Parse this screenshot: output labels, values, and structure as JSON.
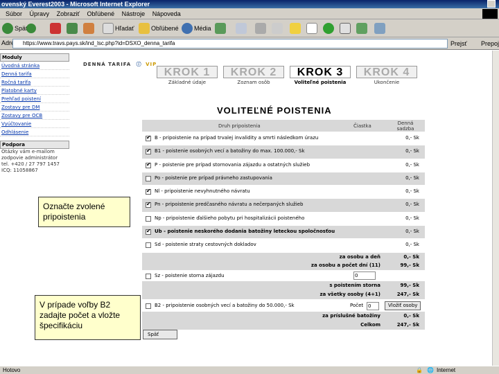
{
  "window": {
    "title": "ovenský Everest2003 - Microsoft Internet Explorer"
  },
  "menu": [
    "Súbor",
    "Úpravy",
    "Zobraziť",
    "Obľúbené",
    "Nástroje",
    "Nápoveda"
  ],
  "toolbar": {
    "back": "Späť",
    "search": "Hľadať",
    "favorites": "Obľúbené",
    "media": "Média"
  },
  "address": {
    "label": "Adresa",
    "url": "https://www.travs.pays.sk/ind_lsc.php?id=DSXO_denna_tarifa",
    "go": "Prejsť",
    "links": "Prepojenia"
  },
  "sidebar": {
    "modules_heading": "Moduly",
    "items": [
      "Úvodná stránka",
      "Denná tarifa",
      "Ročná tarifa",
      "Platobné karty",
      "Prehľad poistení",
      "Zostavy pre DM",
      "Zostavy pre OCB",
      "Vyúčtovanie",
      "Odhlásenie"
    ],
    "support_heading": "Podpora",
    "support_text": "Otázky vám e-mailom\nzodpovie administrátor\ntel. +420 / 27 797 1457\nICQ: 11058867"
  },
  "page": {
    "breadcrumb": "DENNÁ TARIFA",
    "vip": "VIP",
    "heading": "VOLITEĽNÉ POISTENIA"
  },
  "steps": [
    {
      "label": "KROK 1",
      "sub": "Základné údaje"
    },
    {
      "label": "KROK 2",
      "sub": "Zoznam osôb"
    },
    {
      "label": "KROK 3",
      "sub": "Voliteľné poistenia",
      "active": true
    },
    {
      "label": "KROK 4",
      "sub": "Ukončenie"
    }
  ],
  "table": {
    "col_type": "Druh pripoistenia",
    "col_amount": "Čiastka",
    "col_daily": "Denná sadzba",
    "rows": [
      {
        "checked": true,
        "desc": "B - pripoistenie na prípad trvalej invalidity a smrti následkom úrazu",
        "price": "0,- Sk"
      },
      {
        "checked": true,
        "desc": "B1 - poistenie osobných vecí a batožiny do max. 100.000,- Sk",
        "price": "0,- Sk"
      },
      {
        "checked": true,
        "desc": "P - poistenie pre prípad stornovania zájazdu a ostatných služieb",
        "price": "0,- Sk"
      },
      {
        "checked": false,
        "desc": "Po - poistenie pre prípad právneho zastupovania",
        "price": "0,- Sk"
      },
      {
        "checked": true,
        "desc": "Nl - pripoistenie nevyhnutného návratu",
        "price": "0,- Sk"
      },
      {
        "checked": true,
        "desc": "Pn - pripoistenie predčasného návratu a nečerpaných služieb",
        "price": "0,- Sk"
      },
      {
        "checked": false,
        "desc": "Np - pripoistenie ďalšieho pobytu pri hospitalizácii poisteného",
        "price": "0,- Sk"
      },
      {
        "checked": true,
        "desc": "Ub - poistenie neskorého dodania batožiny leteckou spoločnosťou",
        "price": "0,- Sk"
      },
      {
        "checked": false,
        "desc": "Sd - poistenie straty cestovných dokladov",
        "price": "0,- Sk"
      }
    ],
    "sum1_label": "za osobu a deň",
    "sum1_value": "0,- Sk",
    "sum2_label": "za osobu a počet dní (11)",
    "sum2_value": "99,- Sk",
    "storno_desc": "Sz - poistenie storna zájazdu",
    "storno_input": "0",
    "sum3_label": "s poistením storna",
    "sum3_value": "99,- Sk",
    "sum4_label": "za všetky osoby (4+1)",
    "sum4_value": "247,- Sk",
    "b2_desc": "B2 - pripoistenie osobných vecí a batožiny do 50.000,- Sk",
    "b2_count_label": "Počet",
    "b2_count": "0",
    "b2_button": "Vložiť osoby",
    "sum5_label": "za príslušné batožiny",
    "sum5_value": "0,- Sk",
    "total_label": "Celkom",
    "total_value": "247,- Sk",
    "back_button": "Späť"
  },
  "callouts": {
    "first": "Označte zvolené pripoistenia",
    "second": "V prípade voľby B2 zadajte počet a vložte špecifikáciu"
  },
  "status": {
    "left": "Hotovo",
    "right": "Internet"
  }
}
